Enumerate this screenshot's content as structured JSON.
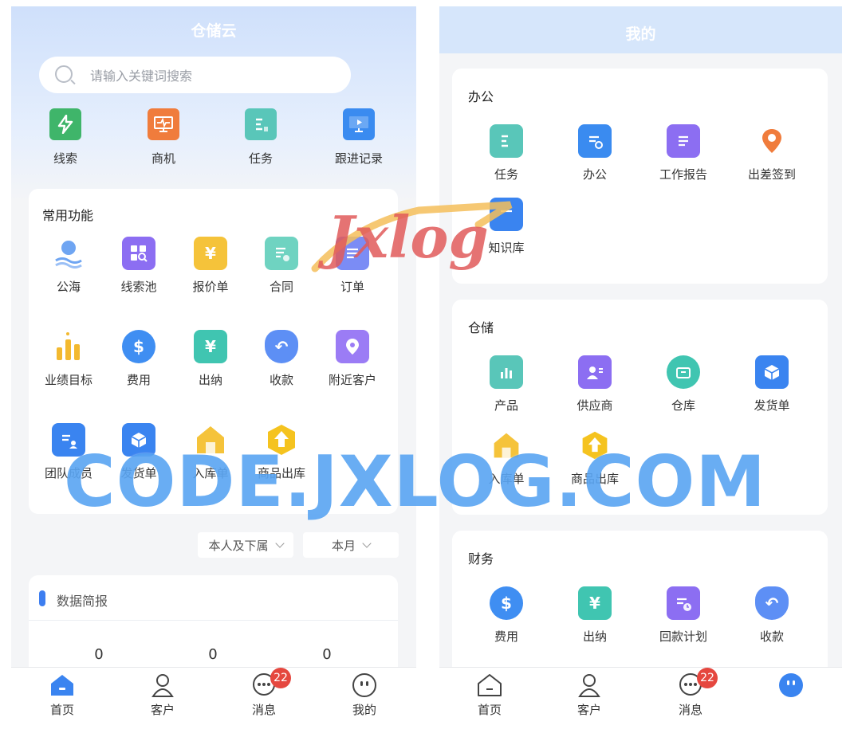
{
  "left": {
    "header": {
      "title": "仓储云"
    },
    "search": {
      "placeholder": "请输入关键词搜索"
    },
    "quick_actions": [
      {
        "label": "线索",
        "icon": "lightning-icon",
        "color": "#3fb56a"
      },
      {
        "label": "商机",
        "icon": "monitor-pulse-icon",
        "color": "#f07c3c"
      },
      {
        "label": "任务",
        "icon": "task-doc-icon",
        "color": "#59c6b9"
      },
      {
        "label": "跟进记录",
        "icon": "screen-play-icon",
        "color": "#3a8bf0"
      }
    ],
    "common": {
      "title": "常用功能",
      "items": [
        {
          "label": "公海",
          "icon": "person-sea-icon",
          "color": "#6fa5f2"
        },
        {
          "label": "线索池",
          "icon": "grid-search-icon",
          "color": "#8c6ef2"
        },
        {
          "label": "报价单",
          "icon": "yuan-clipboard-icon",
          "color": "#f5c33a"
        },
        {
          "label": "合同",
          "icon": "contract-icon",
          "color": "#6fd3c1"
        },
        {
          "label": "订单",
          "icon": "order-icon",
          "color": "#7b8cf5"
        },
        {
          "label": "业绩目标",
          "icon": "bar-target-icon",
          "color": "#f3b92f"
        },
        {
          "label": "费用",
          "icon": "dollar-coin-icon",
          "color": "#3f8ef2"
        },
        {
          "label": "出纳",
          "icon": "yuan-house-icon",
          "color": "#40c5b1"
        },
        {
          "label": "收款",
          "icon": "money-bag-icon",
          "color": "#5d8ff5"
        },
        {
          "label": "附近客户",
          "icon": "map-pin-icon",
          "color": "#9b7cf5"
        },
        {
          "label": "团队成员",
          "icon": "team-doc-icon",
          "color": "#3a84f0"
        },
        {
          "label": "发货单",
          "icon": "box-icon",
          "color": "#3a84f0"
        },
        {
          "label": "入库单",
          "icon": "warehouse-in-icon",
          "color": "#f5c33a"
        },
        {
          "label": "商品出库",
          "icon": "arrow-up-hex-icon",
          "color": "#f5c31f"
        }
      ]
    },
    "filters": {
      "scope": "本人及下属",
      "period": "本月"
    },
    "report": {
      "title": "数据简报",
      "values": [
        "0",
        "0",
        "0"
      ]
    },
    "tabbar": [
      {
        "label": "首页",
        "icon": "home-icon",
        "active": true
      },
      {
        "label": "客户",
        "icon": "user-icon"
      },
      {
        "label": "消息",
        "icon": "chat-icon",
        "badge": "22"
      },
      {
        "label": "我的",
        "icon": "smile-icon"
      }
    ]
  },
  "right": {
    "header": {
      "title": "我的"
    },
    "office": {
      "title": "办公",
      "items": [
        {
          "label": "任务",
          "icon": "task-doc-icon",
          "color": "#59c6b9"
        },
        {
          "label": "办公",
          "icon": "office-doc-icon",
          "color": "#3a8bf0"
        },
        {
          "label": "工作报告",
          "icon": "report-book-icon",
          "color": "#8c6ef2"
        },
        {
          "label": "出差签到",
          "icon": "location-pin-icon",
          "color": "#f07c3c"
        },
        {
          "label": "知识库",
          "icon": "knowledge-book-icon",
          "color": "#3a84f0"
        }
      ]
    },
    "storage": {
      "title": "仓储",
      "items": [
        {
          "label": "产品",
          "icon": "product-chart-icon",
          "color": "#59c6b9"
        },
        {
          "label": "供应商",
          "icon": "supplier-card-icon",
          "color": "#8c6ef2"
        },
        {
          "label": "仓库",
          "icon": "warehouse-box-icon",
          "color": "#40c5b1"
        },
        {
          "label": "发货单",
          "icon": "box-icon",
          "color": "#3a84f0"
        },
        {
          "label": "入库单",
          "icon": "warehouse-in-icon",
          "color": "#f5c33a"
        },
        {
          "label": "商品出库",
          "icon": "arrow-up-hex-icon",
          "color": "#f5c31f"
        }
      ]
    },
    "finance": {
      "title": "财务",
      "items": [
        {
          "label": "费用",
          "icon": "dollar-coin-icon",
          "color": "#3f8ef2"
        },
        {
          "label": "出纳",
          "icon": "yuan-house-icon",
          "color": "#40c5b1"
        },
        {
          "label": "回款计划",
          "icon": "payment-plan-icon",
          "color": "#8c6ef2"
        },
        {
          "label": "收款",
          "icon": "money-bag-icon",
          "color": "#5d8ff5"
        }
      ]
    },
    "tabbar": [
      {
        "label": "首页",
        "icon": "home-outline-icon"
      },
      {
        "label": "客户",
        "icon": "user-icon"
      },
      {
        "label": "消息",
        "icon": "chat-icon",
        "badge": "22"
      },
      {
        "label": "",
        "icon": "smile-filled-icon",
        "active": true
      }
    ]
  },
  "watermark": {
    "site": "CODE.JXLOG.COM",
    "logo": "Jxlog"
  }
}
